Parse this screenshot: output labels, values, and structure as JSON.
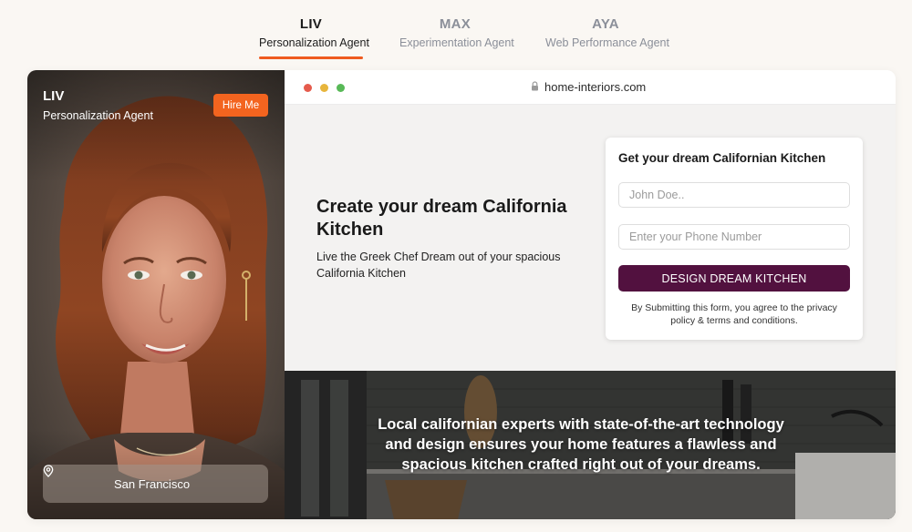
{
  "agents": [
    {
      "code": "LIV",
      "role": "Personalization Agent",
      "active": true
    },
    {
      "code": "MAX",
      "role": "Experimentation Agent",
      "active": false
    },
    {
      "code": "AYA",
      "role": "Web Performance Agent",
      "active": false
    }
  ],
  "profile": {
    "name": "LIV",
    "role": "Personalization Agent",
    "hire_label": "Hire Me",
    "location": "San Francisco",
    "location_icon": "location-pin-icon"
  },
  "browser": {
    "url": "home-interiors.com",
    "lock_icon": "lock-icon"
  },
  "hero": {
    "title": "Create your dream California Kitchen",
    "subtitle": "Live the Greek Chef Dream out of your spacious California Kitchen"
  },
  "form": {
    "title": "Get your dream Californian Kitchen",
    "name_placeholder": "John Doe..",
    "phone_placeholder": "Enter your Phone Number",
    "submit_label": "DESIGN DREAM KITCHEN",
    "consent": "By Submitting this form, you agree to the privacy policy & terms and conditions."
  },
  "banner": {
    "text": "Local californian experts with state-of-the-art technology and design ensures your home features a flawless and spacious kitchen crafted right out of your dreams."
  },
  "colors": {
    "accent": "#f3641f",
    "submit": "#52113f",
    "background": "#faf7f3"
  }
}
